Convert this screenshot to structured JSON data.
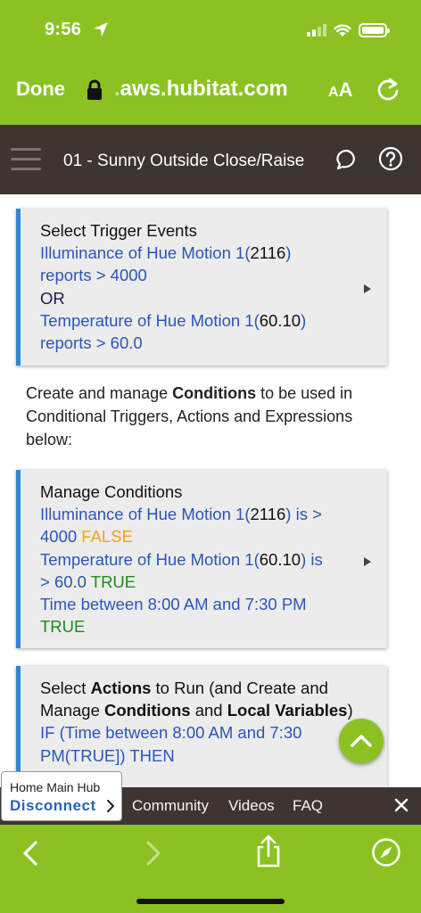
{
  "status_bar": {
    "time": "9:56"
  },
  "browser": {
    "done_label": "Done",
    "url_prefix": ".",
    "url": "aws.hubitat.com",
    "text_size_small": "A",
    "text_size_big": "A"
  },
  "app_header": {
    "title": "01 - Sunny Outside Close/Raise"
  },
  "trigger_card": {
    "title": "Select Trigger Events",
    "line1_prefix": "Illuminance of Hue Motion 1(",
    "line1_value": "2116",
    "line1_suffix": ")",
    "line2": "reports > 4000",
    "or_label": "OR",
    "line3_prefix": "Temperature of Hue Motion 1(",
    "line3_value": "60.10",
    "line3_suffix": ")",
    "line4": "reports > 60.0"
  },
  "conditions_intro": {
    "text_before": "Create and manage ",
    "bold": "Conditions",
    "text_after": " to be used in Conditional Triggers, Actions and Expressions below:"
  },
  "conditions_card": {
    "title": "Manage Conditions",
    "c1_prefix": "Illuminance of Hue Motion 1(",
    "c1_value": "2116",
    "c1_suffix": ") is >",
    "c1_line2": "4000",
    "c1_state": "FALSE",
    "c2_prefix": "Temperature of Hue Motion 1(",
    "c2_value": "60.10",
    "c2_suffix": ") is",
    "c2_line2": "> 60.0",
    "c2_state": "TRUE",
    "c3_line1": "Time between 8:00 AM and 7:30 PM",
    "c3_state": "TRUE"
  },
  "actions_card": {
    "t1": "Select ",
    "t2": "Actions",
    "t3": " to Run (and Create and Manage ",
    "t4": "Conditions",
    "t5": " and ",
    "t6": "Local Variables",
    "t7": ")",
    "l1": "IF (Time between 8:00 AM and 7:30",
    "l2": "PM(TRUE]) THEN"
  },
  "hub": {
    "label": "Home Main Hub",
    "disconnect": "Disconnect"
  },
  "bottom_links": {
    "community": "Community",
    "videos": "Videos",
    "faq": "FAQ"
  },
  "colors": {
    "brand_green": "#8bc222",
    "header_dark": "#3d3532",
    "link_blue": "#2a56b8",
    "false_orange": "#f2a21b",
    "true_green": "#1e8a1e",
    "card_accent": "#2f86d6"
  }
}
